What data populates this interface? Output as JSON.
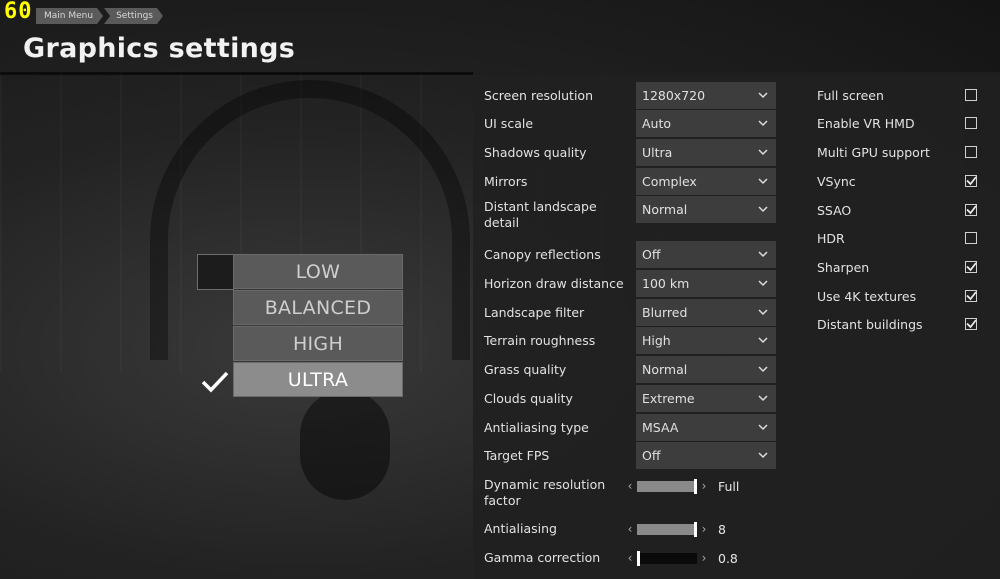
{
  "fps_counter": "60",
  "breadcrumb": [
    "Main Menu",
    "Settings"
  ],
  "page_title": "Graphics settings",
  "presets": [
    {
      "label": "LOW",
      "selected": false
    },
    {
      "label": "BALANCED",
      "selected": false
    },
    {
      "label": "HIGH",
      "selected": false
    },
    {
      "label": "ULTRA",
      "selected": true
    }
  ],
  "dropdowns": [
    {
      "label": "Screen resolution",
      "value": "1280x720"
    },
    {
      "label": "UI scale",
      "value": "Auto"
    },
    {
      "label": "Shadows quality",
      "value": "Ultra"
    },
    {
      "label": "Mirrors",
      "value": "Complex"
    },
    {
      "label": "Distant landscape detail",
      "value": "Normal"
    },
    {
      "label": "Canopy reflections",
      "value": "Off"
    },
    {
      "label": "Horizon draw distance",
      "value": "100 km"
    },
    {
      "label": "Landscape filter",
      "value": "Blurred"
    },
    {
      "label": "Terrain roughness",
      "value": "High"
    },
    {
      "label": "Grass quality",
      "value": "Normal"
    },
    {
      "label": "Clouds quality",
      "value": "Extreme"
    },
    {
      "label": "Antialiasing type",
      "value": "MSAA"
    },
    {
      "label": "Target FPS",
      "value": "Off"
    }
  ],
  "sliders": [
    {
      "label": "Dynamic resolution factor",
      "value": "Full",
      "level": 1.0,
      "dark": false
    },
    {
      "label": "Antialiasing",
      "value": "8",
      "level": 1.0,
      "dark": false
    },
    {
      "label": "Gamma correction",
      "value": "0.8",
      "level": 0.0,
      "dark": true
    }
  ],
  "toggles": [
    {
      "label": "Full screen",
      "checked": false
    },
    {
      "label": "Enable VR HMD",
      "checked": false
    },
    {
      "label": "Multi GPU support",
      "checked": false
    },
    {
      "label": "VSync",
      "checked": true
    },
    {
      "label": "SSAO",
      "checked": true
    },
    {
      "label": "HDR",
      "checked": false
    },
    {
      "label": "Sharpen",
      "checked": true
    },
    {
      "label": "Use 4K textures",
      "checked": true
    },
    {
      "label": "Distant buildings",
      "checked": true
    }
  ],
  "icons": {
    "dropdown": "chevron-down-icon",
    "slider_left": "chevron-left-icon",
    "slider_right": "chevron-right-icon",
    "preset_check": "checkmark-icon"
  },
  "colors": {
    "fps": "#ffff00",
    "preset_selected": "#8c8c8c",
    "preset": "#5a5a5a"
  }
}
